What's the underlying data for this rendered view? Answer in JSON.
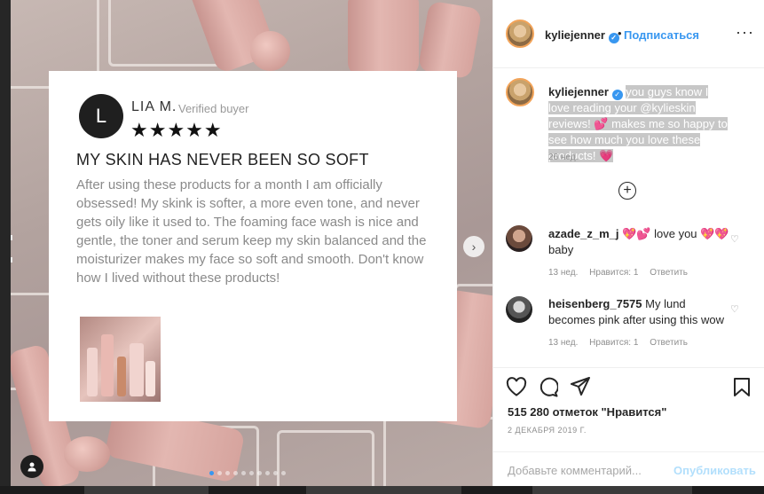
{
  "review": {
    "avatar_letter": "L",
    "name": "LIA M.",
    "verified": "Verified buyer",
    "stars": "★★★★★",
    "title": "MY SKIN HAS NEVER BEEN SO SOFT",
    "body": "After using these products for a month I am officially obsessed! My skink is softer, a more even tone, and never gets oily like it used to. The foaming face wash is nice and gentle, the toner and serum keep my skin balanced and the moisturizer makes my face so soft and smooth. Don't know how I lived without these products!"
  },
  "carousel": {
    "next_glyph": "›",
    "dot_count": 10,
    "active_dot": 0
  },
  "post_header": {
    "username": "kyliejenner",
    "verified_glyph": "✓",
    "separator": "•",
    "follow_label": "Подписаться",
    "more_glyph": "···"
  },
  "caption": {
    "username": "kyliejenner",
    "text": "you guys know I love reading your @kylieskin reviews! 💕 makes me so happy to see how much you love these products! 💗",
    "time": "26 нед."
  },
  "load_more_glyph": "+",
  "comments": [
    {
      "username": "azade_z_m_j",
      "text": "💖💕 love you 💖💖 baby",
      "time": "13 нед.",
      "likes": "Нравится: 1",
      "reply": "Ответить"
    },
    {
      "username": "heisenberg_7575",
      "text": "My lund becomes pink after using this wow",
      "time": "13 нед.",
      "likes": "Нравится: 1",
      "reply": "Ответить"
    }
  ],
  "actions": {
    "like_icon": "heart-icon",
    "comment_icon": "comment-icon",
    "share_icon": "share-icon",
    "save_icon": "bookmark-icon",
    "likes_count": "515 280 отметок \"Нравится\"",
    "date": "2 ДЕКАБРЯ 2019 Г.",
    "comment_placeholder": "Добавьте комментарий...",
    "publish_label": "Опубликовать"
  },
  "colors": {
    "accent": "#3897f0",
    "publish_disabled": "#b2dffc",
    "muted": "#8e8e8e",
    "text": "#262626"
  }
}
